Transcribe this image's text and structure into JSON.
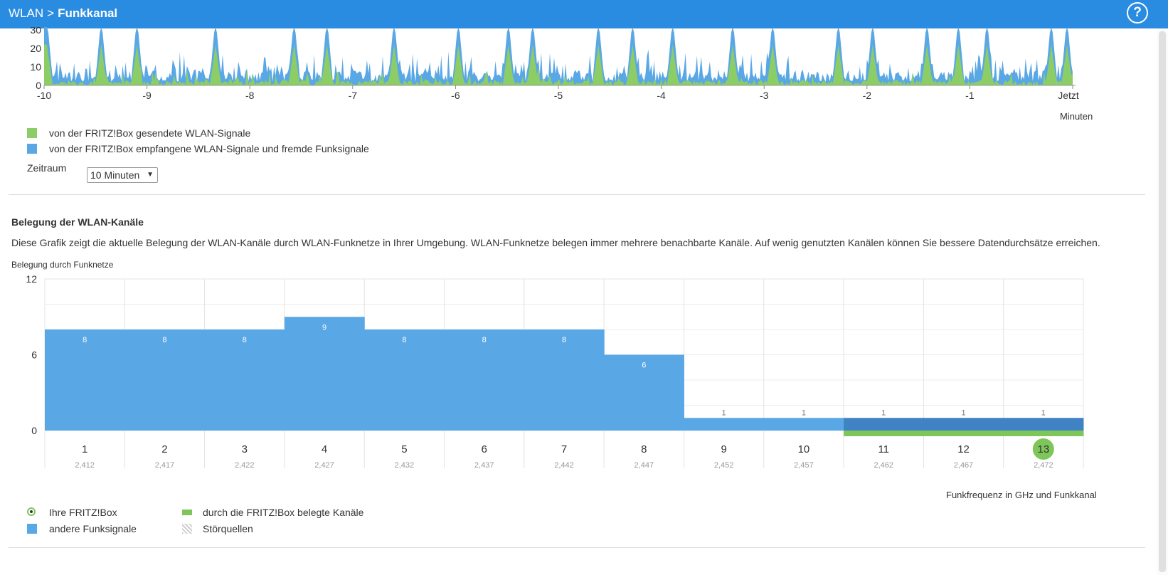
{
  "header": {
    "breadcrumb_parent": "WLAN",
    "breadcrumb_sep": ">",
    "breadcrumb_current": "Funkkanal",
    "help_label": "?"
  },
  "colors": {
    "header": "#2a8ce0",
    "sent_green": "#8ccd66",
    "received_blue": "#5aa7e6",
    "overlap_blue": "#3f83c4",
    "fritzbox_green": "#7ec65a"
  },
  "top_chart": {
    "y_ticks": [
      "30",
      "20",
      "10",
      "0"
    ],
    "x_ticks": [
      "-10",
      "-9",
      "-8",
      "-7",
      "-6",
      "-5",
      "-4",
      "-3",
      "-2",
      "-1",
      "Jetzt"
    ],
    "x_unit": "Minuten"
  },
  "top_legend": {
    "sent": "von der FRITZ!Box gesendete WLAN-Signale",
    "received": "von der FRITZ!Box empfangene WLAN-Signale und fremde Funksignale"
  },
  "zeitraum": {
    "label": "Zeitraum",
    "value": "10 Minuten"
  },
  "section": {
    "title": "Belegung der WLAN-Kanäle",
    "description": "Diese Grafik zeigt die aktuelle Belegung der WLAN-Kanäle durch WLAN-Funknetze in Ihrer Umgebung. WLAN-Funknetze belegen immer mehrere benachbarte Kanäle. Auf wenig genutzten Kanälen können Sie bessere Datendurchsätze erreichen."
  },
  "chart_data": {
    "type": "bar",
    "ylabel": "Belegung durch Funknetze",
    "xlabel": "Funkfrequenz in GHz und Funkkanal",
    "ylim": [
      0,
      12
    ],
    "y_ticks": [
      "12",
      "6",
      "0"
    ],
    "categories": [
      "1",
      "2",
      "3",
      "4",
      "5",
      "6",
      "7",
      "8",
      "9",
      "10",
      "11",
      "12",
      "13"
    ],
    "frequencies": [
      "2,412",
      "2,417",
      "2,422",
      "2,427",
      "2,432",
      "2,437",
      "2,442",
      "2,447",
      "2,452",
      "2,457",
      "2,462",
      "2,467",
      "2,472"
    ],
    "values": [
      8,
      8,
      8,
      9,
      8,
      8,
      8,
      6,
      1,
      1,
      1,
      1,
      1
    ],
    "fritzbox_channels": [
      "11",
      "12",
      "13"
    ],
    "fritzbox_selected_channel": "13"
  },
  "bottom_legend": {
    "ihre": "Ihre FRITZ!Box",
    "andere": "andere Funksignale",
    "belegt": "durch die FRITZ!Box belegte Kanäle",
    "stoer": "Störquellen"
  }
}
